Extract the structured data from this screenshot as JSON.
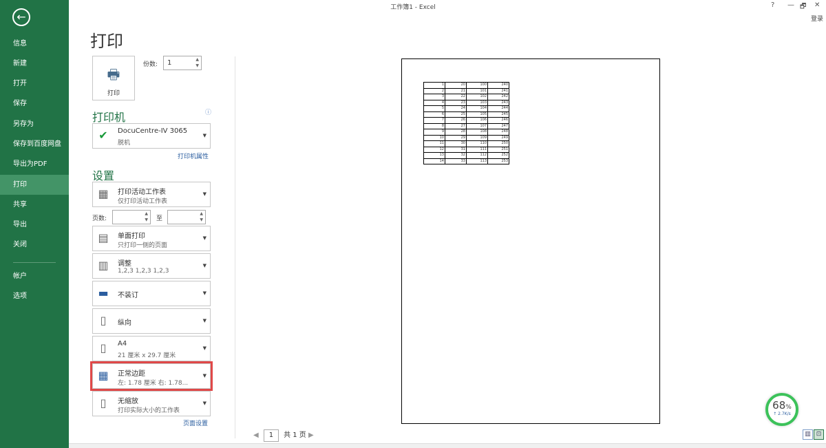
{
  "window": {
    "title": "工作簿1 - Excel",
    "help": "?",
    "minimize": "—",
    "restore": "🗗",
    "close": "✕",
    "login": "登录"
  },
  "sidebar": {
    "back": "←",
    "items": [
      {
        "label": "信息"
      },
      {
        "label": "新建"
      },
      {
        "label": "打开"
      },
      {
        "label": "保存"
      },
      {
        "label": "另存为"
      },
      {
        "label": "保存到百度网盘"
      },
      {
        "label": "导出为PDF"
      },
      {
        "label": "打印"
      },
      {
        "label": "共享"
      },
      {
        "label": "导出"
      },
      {
        "label": "关闭"
      },
      {
        "label": "帐户"
      },
      {
        "label": "选项"
      }
    ],
    "selected": "打印"
  },
  "print": {
    "heading": "打印",
    "button": "打印",
    "copies_label": "份数:",
    "copies": "1"
  },
  "printer": {
    "heading": "打印机",
    "name": "DocuCentre-IV 3065",
    "status": "脱机",
    "properties_link": "打印机属性"
  },
  "settings": {
    "heading": "设置",
    "what": {
      "t1": "打印活动工作表",
      "t2": "仅打印活动工作表"
    },
    "pages_label": "页数:",
    "to_label": "至",
    "pages_from": "",
    "pages_to": "",
    "sides": {
      "t1": "单面打印",
      "t2": "只打印一侧的页面"
    },
    "collate": {
      "t1": "调整",
      "t2": "1,2,3    1,2,3    1,2,3"
    },
    "staple": {
      "t1": "不装订"
    },
    "orientation": {
      "t1": "纵向"
    },
    "paper": {
      "t1": "A4",
      "t2": "21 厘米 x 29.7 厘米"
    },
    "margins": {
      "t1": "正常边距",
      "t2": "左: 1.78 厘米    右: 1.78..."
    },
    "scaling": {
      "t1": "无缩放",
      "t2": "打印实际大小的工作表"
    },
    "page_setup_link": "页面设置"
  },
  "preview": {
    "rows": [
      [
        1,
        20,
        100,
        240
      ],
      [
        2,
        21,
        101,
        241
      ],
      [
        3,
        22,
        102,
        242
      ],
      [
        4,
        23,
        103,
        243
      ],
      [
        5,
        24,
        104,
        244
      ],
      [
        6,
        25,
        105,
        245
      ],
      [
        7,
        26,
        106,
        246
      ],
      [
        8,
        27,
        107,
        247
      ],
      [
        9,
        28,
        108,
        248
      ],
      [
        10,
        29,
        109,
        249
      ],
      [
        11,
        30,
        110,
        250
      ],
      [
        12,
        31,
        111,
        251
      ],
      [
        13,
        32,
        112,
        252
      ],
      [
        14,
        33,
        113,
        253
      ]
    ],
    "page": "1",
    "total": "共 1 页"
  },
  "gauge": {
    "percent": "68",
    "unit": "%",
    "speed": "↑ 2.7K/s"
  }
}
